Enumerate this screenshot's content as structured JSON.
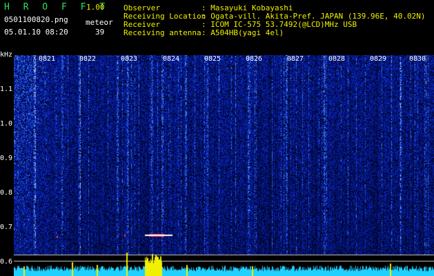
{
  "header": {
    "title": "H R O F F T",
    "version": "1.00",
    "filename": "0501100820.png",
    "datetime": "05.01.10 08:20",
    "meteor_label": "meteor",
    "meteor_count": "39",
    "info": [
      {
        "label": "Observer",
        "value": ": Masayuki Kobayashi"
      },
      {
        "label": "Receiving Location",
        "value": ": Ogata-vill. Akita-Pref. JAPAN (139.96E, 40.02N)"
      },
      {
        "label": "Receiver",
        "value": ": ICOM IC-575 53.7492(@LCD)MHz USB"
      },
      {
        "label": "Receiving antenna",
        "value": ": A504HB(yagi 4el)"
      }
    ]
  },
  "spectrogram": {
    "y_unit": "kHz",
    "y_ticks": [
      "1.1",
      "1.0",
      "0.9",
      "0.8",
      "0.7",
      "0.6"
    ],
    "time_ticks": [
      "0821",
      "0822",
      "0823",
      "0824",
      "0825",
      "0826",
      "0827",
      "0828",
      "0829",
      "0830"
    ],
    "colors": {
      "background": "#000010",
      "noise_low": "#0a1a7a",
      "noise_high": "#2a6aff",
      "signal": "#e0f0ff",
      "power_trace": "#20d0ff",
      "peaks": "#f0f000",
      "meteor": "#ff3030"
    }
  }
}
